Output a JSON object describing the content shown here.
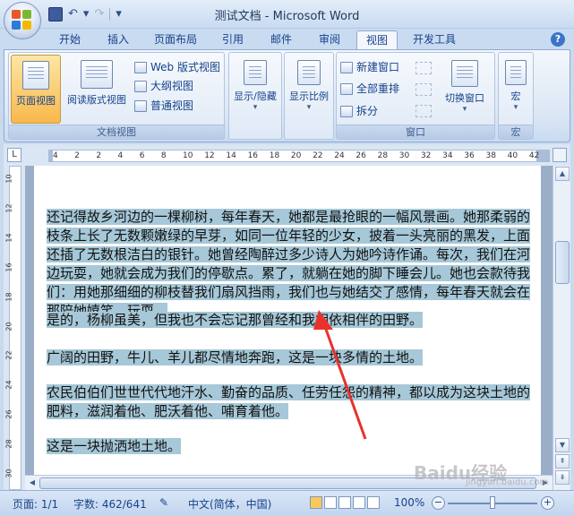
{
  "window": {
    "title": "测试文档 - Microsoft Word"
  },
  "tabs": [
    {
      "label": "开始"
    },
    {
      "label": "插入"
    },
    {
      "label": "页面布局"
    },
    {
      "label": "引用"
    },
    {
      "label": "邮件"
    },
    {
      "label": "审阅"
    },
    {
      "label": "视图",
      "active": true
    },
    {
      "label": "开发工具"
    }
  ],
  "ribbon": {
    "doc_views": {
      "label": "文档视图",
      "print_layout": "页面视图",
      "full_screen_reading": "阅读版式视图",
      "web_layout": "Web 版式视图",
      "outline": "大纲视图",
      "draft": "普通视图"
    },
    "show_hide": "显示/隐藏",
    "zoom": "显示比例",
    "window": {
      "label": "窗口",
      "new_window": "新建窗口",
      "arrange_all": "全部重排",
      "split": "拆分",
      "switch_windows": "切换窗口"
    },
    "macros": {
      "label": "宏",
      "button": "宏"
    }
  },
  "ruler": {
    "corner": "L",
    "ticks": [
      "4",
      "2",
      "2",
      "4",
      "6",
      "8",
      "10",
      "12",
      "14",
      "16",
      "18",
      "20",
      "22",
      "24",
      "26",
      "28",
      "30",
      "32",
      "34",
      "36",
      "38",
      "40",
      "42"
    ]
  },
  "vruler": {
    "ticks": [
      "10",
      "12",
      "14",
      "16",
      "18",
      "20",
      "22",
      "24",
      "26",
      "28",
      "30"
    ]
  },
  "document": {
    "paragraphs": [
      "还记得故乡河边的一棵柳树，每年春天，她都是最抢眼的一幅风景画。她那柔弱的枝条上长了无数颗嫩绿的早芽，如同一位年轻的少女，披着一头亮丽的黑发，上面还插了无数根洁白的银针。她曾经陶醉过多少诗人为她吟诗作诵。每次，我们在河边玩耍，她就会成为我们的停歇点。累了，就躺在她的脚下睡会儿。她也会款待我们：用她那细细的柳枝替我们扇风挡雨，我们也与她结交了感情，每年春天就会在那陪她嬉笑、玩耍。",
      "是的，杨柳虽美，但我也不会忘记那曾经和我相依相伴的田野。",
      "广阔的田野，牛儿、羊儿都尽情地奔跑，这是一块多情的土地。",
      "农民伯伯们世世代代地汗水、勤奋的品质、任劳任怨的精神，都以成为这块土地的肥料，滋润着他、肥沃着他、哺育着他。",
      "这是一块抛洒地土地。"
    ]
  },
  "statusbar": {
    "page": "页面: 1/1",
    "words": "字数: 462/641",
    "language": "中文(简体，中国)",
    "zoom": "100%"
  },
  "watermark": {
    "brand": "Baidu经验",
    "url": "jingyan.baidu.com"
  },
  "colors": {
    "selection": "#a6c8d8",
    "annotation_arrow": "#e8322c"
  }
}
